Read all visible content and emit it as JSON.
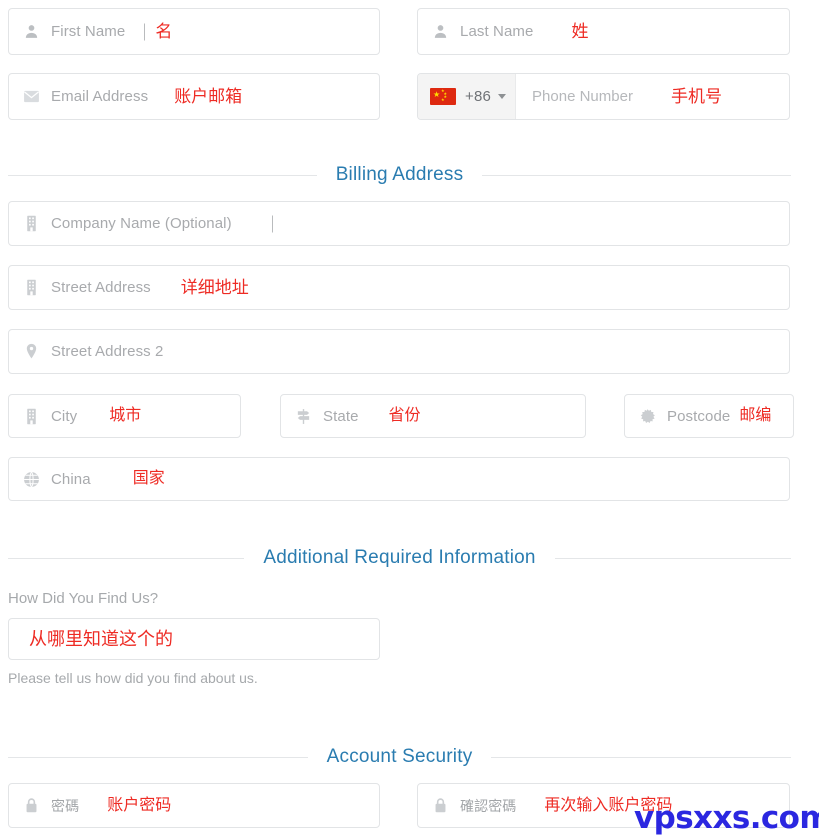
{
  "form": {
    "personal": {
      "first_name": {
        "placeholder": "First Name",
        "annotation": "名",
        "icon": "user-icon"
      },
      "last_name": {
        "placeholder": "Last Name",
        "annotation": "姓",
        "icon": "user-icon"
      },
      "email": {
        "placeholder": "Email Address",
        "annotation": "账户邮箱",
        "icon": "envelope-icon"
      },
      "phone": {
        "placeholder": "Phone Number",
        "annotation": "手机号",
        "dial_code": "+86",
        "country_flag": "china-flag-icon"
      }
    },
    "billing": {
      "heading": "Billing Address",
      "company": {
        "placeholder": "Company Name (Optional)",
        "annotation": "",
        "icon": "building-icon"
      },
      "street1": {
        "placeholder": "Street Address",
        "annotation": "详细地址",
        "icon": "building-icon"
      },
      "street2": {
        "placeholder": "Street Address 2",
        "annotation": "",
        "icon": "map-pin-icon"
      },
      "city": {
        "placeholder": "City",
        "annotation": "城市",
        "icon": "building-icon"
      },
      "state": {
        "placeholder": "State",
        "annotation": "省份",
        "icon": "signpost-icon"
      },
      "postcode": {
        "placeholder": "Postcode",
        "annotation": "邮编",
        "icon": "starburst-icon"
      },
      "country": {
        "value": "China",
        "annotation": "国家",
        "icon": "globe-icon"
      }
    },
    "additional": {
      "heading": "Additional Required Information",
      "how_did_you_find_us": {
        "label": "How Did You Find Us?",
        "value": "",
        "annotation": "从哪里知道这个的",
        "help": "Please tell us how did you find about us."
      }
    },
    "security": {
      "heading": "Account Security",
      "password": {
        "placeholder": "密碼",
        "annotation": "账户密码",
        "icon": "lock-icon"
      },
      "confirm_password": {
        "placeholder": "確認密碼",
        "annotation": "再次输入账户密码",
        "icon": "lock-icon"
      }
    }
  },
  "watermark": {
    "text": "vpsxxs.com"
  },
  "colors": {
    "accent_heading": "#2a7cb0",
    "annotation_red": "#ee2b24",
    "placeholder_gray": "#a8aaad",
    "border_gray": "#e2e4e6",
    "watermark_blue": "#2b27e0",
    "flag_red": "#de2910"
  }
}
